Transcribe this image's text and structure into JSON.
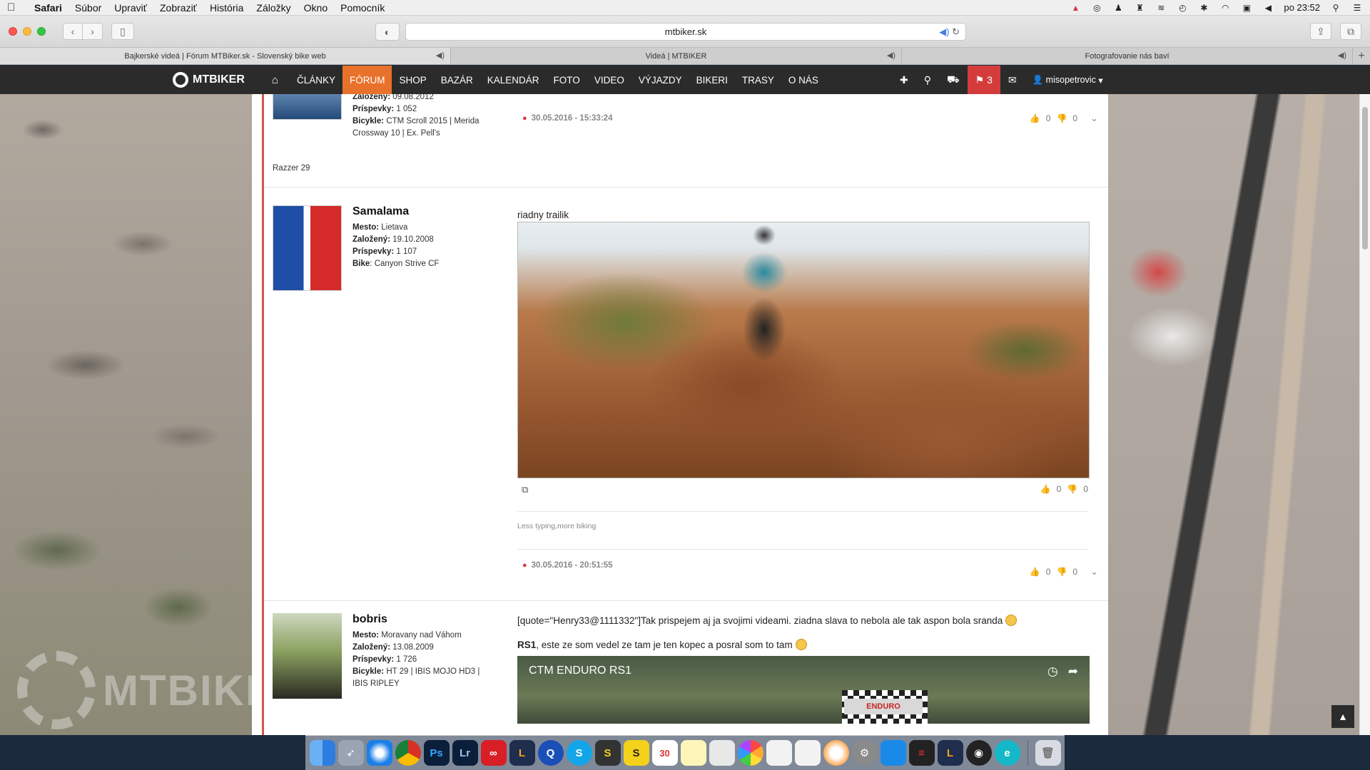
{
  "menubar": {
    "app": "Safari",
    "items": [
      "Súbor",
      "Upraviť",
      "Zobraziť",
      "História",
      "Záložky",
      "Okno",
      "Pomocník"
    ],
    "clock": "po 23:52"
  },
  "browser": {
    "url": "mtbiker.sk",
    "tabs": [
      "Bajkerské videá | Fórum MTBiker.sk - Slovenský bike web",
      "Videá | MTBIKER",
      "Fotografovanie nás baví"
    ]
  },
  "sitenav": {
    "logo": "MTBIKER",
    "items": [
      "ČLÁNKY",
      "FÓRUM",
      "SHOP",
      "BAZÁR",
      "KALENDÁR",
      "FOTO",
      "VIDEO",
      "VÝJAZDY",
      "BIKERI",
      "TRASY",
      "O NÁS"
    ],
    "active": "FÓRUM",
    "notifications": "3",
    "user": "misopetrovic"
  },
  "posts": {
    "first": {
      "meta_founded_label": "Založený:",
      "meta_founded": "09.08.2012",
      "meta_posts_label": "Príspevky:",
      "meta_posts": "1 052",
      "meta_bikes_label": "Bicykle:",
      "meta_bikes": "CTM Scroll 2015 | Merida Crossway 10 | Ex. Pell's",
      "meta_bikes_overflow": "Razzer 29",
      "date": "30.05.2016 - 15:33:24",
      "up": "0",
      "down": "0"
    },
    "second": {
      "name": "Samalama",
      "city_label": "Mesto:",
      "city": "Lietava",
      "founded_label": "Založený:",
      "founded": "19.10.2008",
      "posts_label": "Príspevky:",
      "posts": "1 107",
      "bike_label": "Bike",
      "bike": "Canyon Strive CF",
      "text": "riadny trailik",
      "media_up": "0",
      "media_down": "0",
      "signature": "Less typing,more biking",
      "date": "30.05.2016 - 20:51:55",
      "up": "0",
      "down": "0"
    },
    "third": {
      "name": "bobris",
      "city_label": "Mesto:",
      "city": "Moravany nad Váhom",
      "founded_label": "Založený:",
      "founded": "13.08.2009",
      "posts_label": "Príspevky:",
      "posts": "1 726",
      "bikes_label": "Bicykle:",
      "bikes": "HT 29 | IBIS MOJO HD3 | IBIS RIPLEY",
      "quote": "[quote=\"Henry33@1111332\"]Tak prispejem aj ja svojimi videami. ziadna slava to nebola ale tak aspon bola sranda",
      "rs1_bold": "RS1",
      "rs1_rest": ", este ze som vedel ze tam je ten kopec a posral som to tam",
      "video_title": "CTM ENDURO RS1",
      "video_sign": "ENDURO"
    }
  },
  "colors": {
    "accent": "#e8722b",
    "navbar": "#2b2b2b",
    "flag": "#d43c3c"
  }
}
